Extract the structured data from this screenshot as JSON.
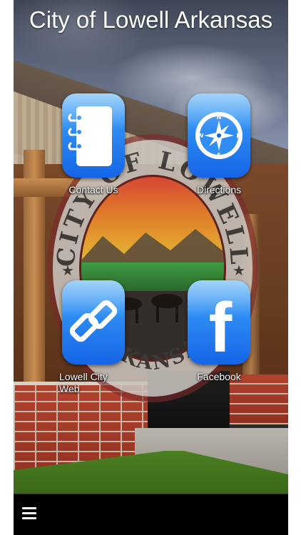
{
  "app": {
    "title": "City of Lowell Arkansas"
  },
  "tiles": [
    {
      "label": "Contact Us",
      "icon": "notebook-icon"
    },
    {
      "label": "Directions",
      "icon": "compass-icon"
    },
    {
      "label": "Lowell City Web",
      "icon": "link-icon"
    },
    {
      "label": "Facebook",
      "icon": "facebook-icon"
    }
  ],
  "compass": {
    "n": "N",
    "e": "E",
    "s": "S",
    "w": "W"
  },
  "facebook_glyph": "f",
  "seal": {
    "top_text": "CITY OF LOWELL",
    "bottom_text": "ARKANSAS"
  },
  "bottom_bar": {
    "menu_icon": "hamburger-menu-icon"
  },
  "colors": {
    "tile_top": "#6fbdf8",
    "tile_bottom": "#1565e6",
    "bar": "#000000",
    "title": "#ffffff"
  }
}
